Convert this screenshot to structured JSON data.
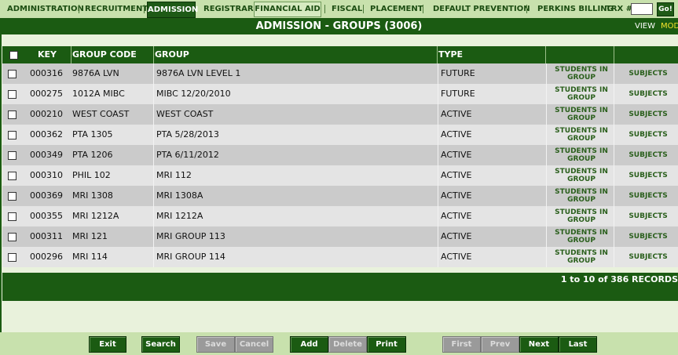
{
  "nav": {
    "tabs": [
      {
        "label": "ADMINISTRATION"
      },
      {
        "label": "RECRUITMENT"
      },
      {
        "label": "ADMISSION"
      },
      {
        "label": "REGISTRAR"
      },
      {
        "label": "FINANCIAL AID"
      },
      {
        "label": "FISCAL"
      },
      {
        "label": "PLACEMENT"
      },
      {
        "label": "DEFAULT PREVENTION"
      },
      {
        "label": "PERKINS BILLING"
      }
    ],
    "trx_label": "TRX #:",
    "trx_value": "",
    "go_label": "Go!"
  },
  "header": {
    "title": "ADMISSION - GROUPS (3006)",
    "view_label": "VIEW",
    "mod_label": "MOD"
  },
  "grid": {
    "columns": {
      "key": "KEY",
      "group_code": "GROUP CODE",
      "group": "GROUP",
      "type": "TYPE"
    },
    "rows": [
      {
        "key": "000316",
        "group_code": "9876A LVN",
        "group": "9876A LVN LEVEL 1",
        "type": "FUTURE",
        "students_link": "STUDENTS IN GROUP",
        "subjects_link": "SUBJECTS"
      },
      {
        "key": "000275",
        "group_code": "1012A MIBC",
        "group": "MIBC 12/20/2010",
        "type": "FUTURE",
        "students_link": "STUDENTS IN GROUP",
        "subjects_link": "SUBJECTS"
      },
      {
        "key": "000210",
        "group_code": "WEST COAST",
        "group": "WEST COAST",
        "type": "ACTIVE",
        "students_link": "STUDENTS IN GROUP",
        "subjects_link": "SUBJECTS"
      },
      {
        "key": "000362",
        "group_code": "PTA 1305",
        "group": "PTA 5/28/2013",
        "type": "ACTIVE",
        "students_link": "STUDENTS IN GROUP",
        "subjects_link": "SUBJECTS"
      },
      {
        "key": "000349",
        "group_code": "PTA 1206",
        "group": "PTA 6/11/2012",
        "type": "ACTIVE",
        "students_link": "STUDENTS IN GROUP",
        "subjects_link": "SUBJECTS"
      },
      {
        "key": "000310",
        "group_code": "PHIL 102",
        "group": "MRI 112",
        "type": "ACTIVE",
        "students_link": "STUDENTS IN GROUP",
        "subjects_link": "SUBJECTS"
      },
      {
        "key": "000369",
        "group_code": "MRI 1308",
        "group": "MRI 1308A",
        "type": "ACTIVE",
        "students_link": "STUDENTS IN GROUP",
        "subjects_link": "SUBJECTS"
      },
      {
        "key": "000355",
        "group_code": "MRI 1212A",
        "group": "MRI 1212A",
        "type": "ACTIVE",
        "students_link": "STUDENTS IN GROUP",
        "subjects_link": "SUBJECTS"
      },
      {
        "key": "000311",
        "group_code": "MRI 121",
        "group": "MRI GROUP 113",
        "type": "ACTIVE",
        "students_link": "STUDENTS IN GROUP",
        "subjects_link": "SUBJECTS"
      },
      {
        "key": "000296",
        "group_code": "MRI 114",
        "group": "MRI GROUP 114",
        "type": "ACTIVE",
        "students_link": "STUDENTS IN GROUP",
        "subjects_link": "SUBJECTS"
      }
    ],
    "records_text": "1 to 10 of 386 RECORDS"
  },
  "toolbar": {
    "buttons": [
      {
        "label": "Exit",
        "enabled": true
      },
      {
        "label": "Search",
        "enabled": true
      },
      {
        "label": "Save",
        "enabled": false
      },
      {
        "label": "Cancel",
        "enabled": false
      },
      {
        "label": "Add",
        "enabled": true
      },
      {
        "label": "Delete",
        "enabled": false
      },
      {
        "label": "Print",
        "enabled": true
      },
      {
        "label": "First",
        "enabled": false
      },
      {
        "label": "Prev",
        "enabled": false
      },
      {
        "label": "Next",
        "enabled": true
      },
      {
        "label": "Last",
        "enabled": true
      }
    ]
  },
  "colors": {
    "brand_green": "#1b5b12",
    "nav_bg": "#c8e1ad",
    "row_odd": "#cbcbcb",
    "row_even": "#e4e4e4",
    "mod_highlight": "#f4e32b",
    "disabled_button": "#9a9a9a"
  }
}
